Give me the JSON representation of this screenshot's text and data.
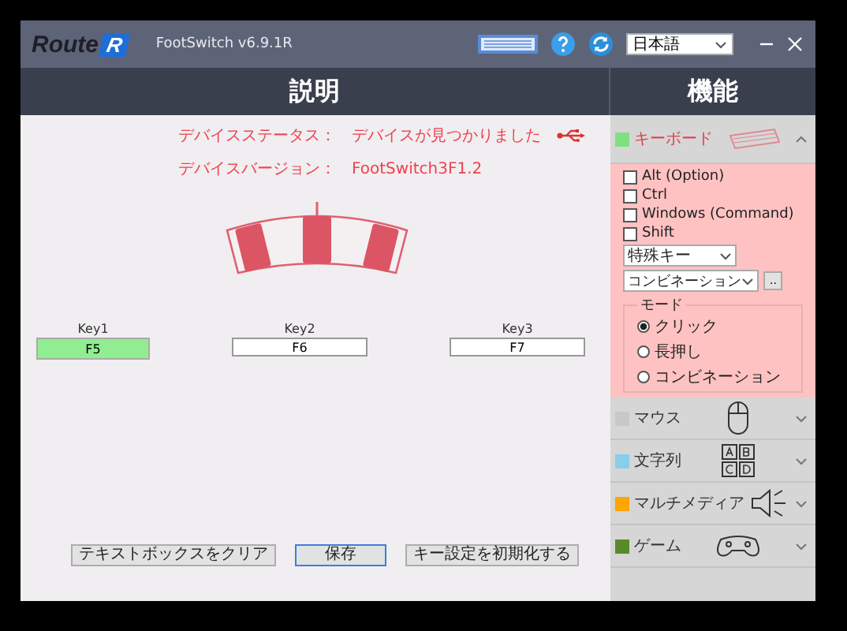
{
  "title_bar": {
    "logo": "Route",
    "logo_mark": "R",
    "version": "FootSwitch v6.9.1R",
    "language": "日本語"
  },
  "headers": {
    "left": "説明",
    "right": "機能"
  },
  "status": [
    {
      "label": "デバイスステータス：",
      "value": "デバイスが見つかりました",
      "connected": true
    },
    {
      "label": "デバイスバージョン：",
      "value": "FootSwitch3F1.2",
      "connected": false
    }
  ],
  "keys": [
    {
      "label": "Key1",
      "value": "F5",
      "selected": true
    },
    {
      "label": "Key2",
      "value": "F6",
      "selected": false
    },
    {
      "label": "Key3",
      "value": "F7",
      "selected": false
    }
  ],
  "buttons": [
    {
      "label": "テキストボックスをクリア",
      "focused": false
    },
    {
      "label": "保存",
      "focused": true
    },
    {
      "label": "キー設定を初期化する",
      "focused": false
    }
  ],
  "sections": [
    {
      "label": "キーボード",
      "kind": "keyboard",
      "color": "#80e080",
      "expanded": true
    },
    {
      "label": "マウス",
      "kind": "mouse",
      "color": "#c8c8c8",
      "expanded": false
    },
    {
      "label": "文字列",
      "kind": "letters",
      "color": "#87ceeb",
      "expanded": false
    },
    {
      "label": "マルチメディア",
      "kind": "speaker",
      "color": "#ffa500",
      "expanded": false
    },
    {
      "label": "ゲーム",
      "kind": "gamepad",
      "color": "#5a8a28",
      "expanded": false
    }
  ],
  "keyboard_panel": {
    "modifiers": [
      {
        "label": "Alt (Option)",
        "checked": false
      },
      {
        "label": "Ctrl",
        "checked": false
      },
      {
        "label": "Windows (Command)",
        "checked": false
      },
      {
        "label": "Shift",
        "checked": false
      }
    ],
    "special_key": "特殊キー",
    "combination": "コンビネーション",
    "more_button": "..",
    "mode_label": "モード",
    "modes": [
      {
        "label": "クリック",
        "selected": true
      },
      {
        "label": "長押し",
        "selected": false
      },
      {
        "label": "コンビネーション",
        "selected": false
      }
    ]
  }
}
